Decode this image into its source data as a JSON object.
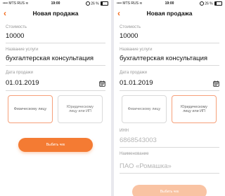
{
  "status_bar": {
    "carrier": "MTS RUS",
    "time": "19:00",
    "battery": "26 %"
  },
  "nav": {
    "back_glyph": "‹",
    "title": "Новая продажа"
  },
  "form": {
    "cost_label": "Стоимость",
    "cost_value": "10000",
    "service_label": "Название услуги",
    "service_value": "бухгалтерская консультация",
    "date_label": "Дата продажи",
    "date_value": "01.01.2019"
  },
  "client_type": {
    "individual": "Физическому лицу",
    "legal": "Юридическому лицу или ИП"
  },
  "legal_fields": {
    "inn_label": "ИНН",
    "inn_value": "6868543003",
    "name_label": "Наименование",
    "name_value": "ПАО «Ромашка»"
  },
  "screens": {
    "left": {
      "selected": "individual",
      "submit_label": "Выбить чек"
    },
    "right": {
      "selected": "legal",
      "submit_label": "Выбить чек"
    }
  },
  "colors": {
    "accent": "#f26a1b",
    "button": "#f47b33",
    "selected_border": "#f6a07a"
  },
  "icons": [
    "back-chevron-icon",
    "calendar-icon",
    "signal-icon",
    "wifi-icon",
    "alarm-icon",
    "battery-icon"
  ]
}
